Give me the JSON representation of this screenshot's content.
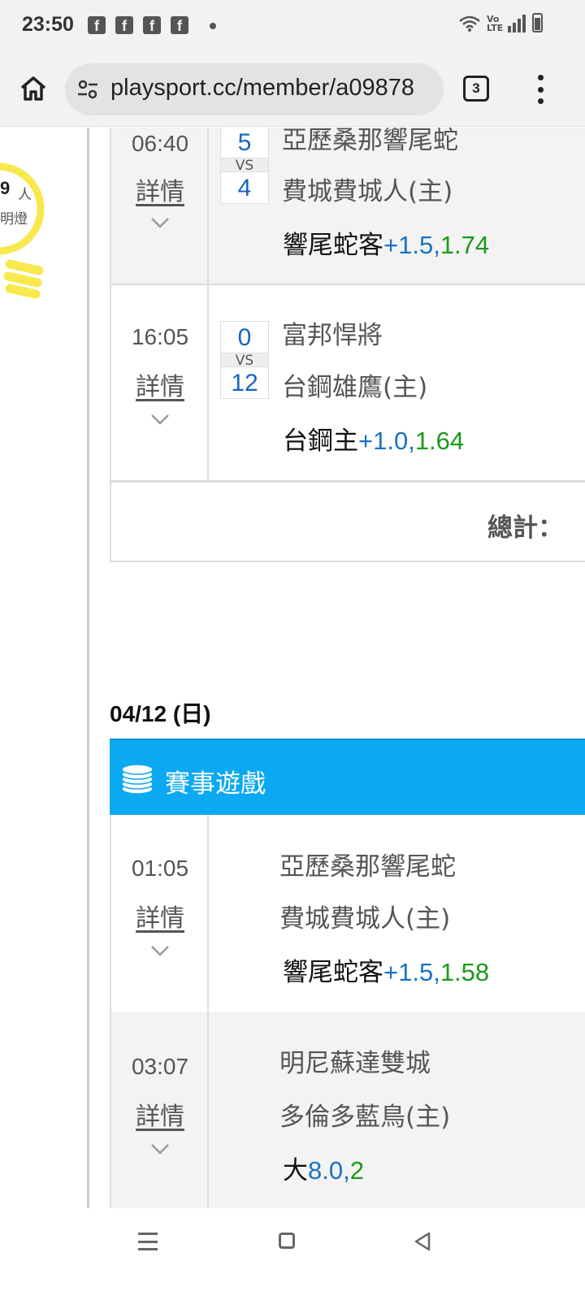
{
  "status_bar": {
    "time": "23:50",
    "notification_icons": [
      "facebook-icon",
      "facebook-icon",
      "facebook-icon",
      "facebook-icon",
      "dot-icon"
    ],
    "right_icons": [
      "wifi-icon",
      "volte-icon",
      "signal-icon",
      "battery-icon"
    ],
    "volte_text_top": "Vo",
    "volte_text_bottom": "LTE"
  },
  "browser": {
    "url": "playsport.cc/member/a09878",
    "tab_count": "3",
    "icons": [
      "home-icon",
      "site-settings-icon",
      "more-vert-icon"
    ]
  },
  "sidebar": {
    "count": "9",
    "count_unit": "人",
    "label": "明燈",
    "icon": "lightbulb-icon",
    "accent_color": "#f7e94d"
  },
  "section1": {
    "games": [
      {
        "time": "06:40",
        "detail_label": "詳情",
        "away_score": "5",
        "vs": "VS",
        "home_score": "4",
        "away_team": "亞歷桑那響尾蛇",
        "home_team": "費城費城人(主)",
        "pick_label": "響尾蛇客",
        "pick_line": "+1.5,",
        "pick_odds": "1.74"
      },
      {
        "time": "16:05",
        "detail_label": "詳情",
        "away_score": "0",
        "vs": "VS",
        "home_score": "12",
        "away_team": "富邦悍將",
        "home_team": "台鋼雄鷹(主)",
        "pick_label": "台鋼主",
        "pick_line": "+1.0,",
        "pick_odds": "1.64"
      }
    ],
    "total_label": "總計："
  },
  "section2": {
    "date": "04/12 (日)",
    "header_title": "賽事遊戲",
    "header_icon": "coins-icon",
    "header_color": "#0aa9f2",
    "games": [
      {
        "time": "01:05",
        "detail_label": "詳情",
        "away_team": "亞歷桑那響尾蛇",
        "home_team": "費城費城人(主)",
        "pick_label": "響尾蛇客",
        "pick_line": "+1.5,",
        "pick_odds": "1.58"
      },
      {
        "time": "03:07",
        "detail_label": "詳情",
        "away_team": "明尼蘇達雙城",
        "home_team": "多倫多藍鳥(主)",
        "pick_label": "大",
        "pick_line": "8.0,",
        "pick_odds": "2"
      }
    ]
  },
  "colors": {
    "line_blue": "#1a73c4",
    "odds_green": "#1a9a1a",
    "score_blue": "#1565c0"
  },
  "nav_bar": {
    "icons": [
      "recent-apps-icon",
      "home-nav-icon",
      "back-icon"
    ]
  }
}
